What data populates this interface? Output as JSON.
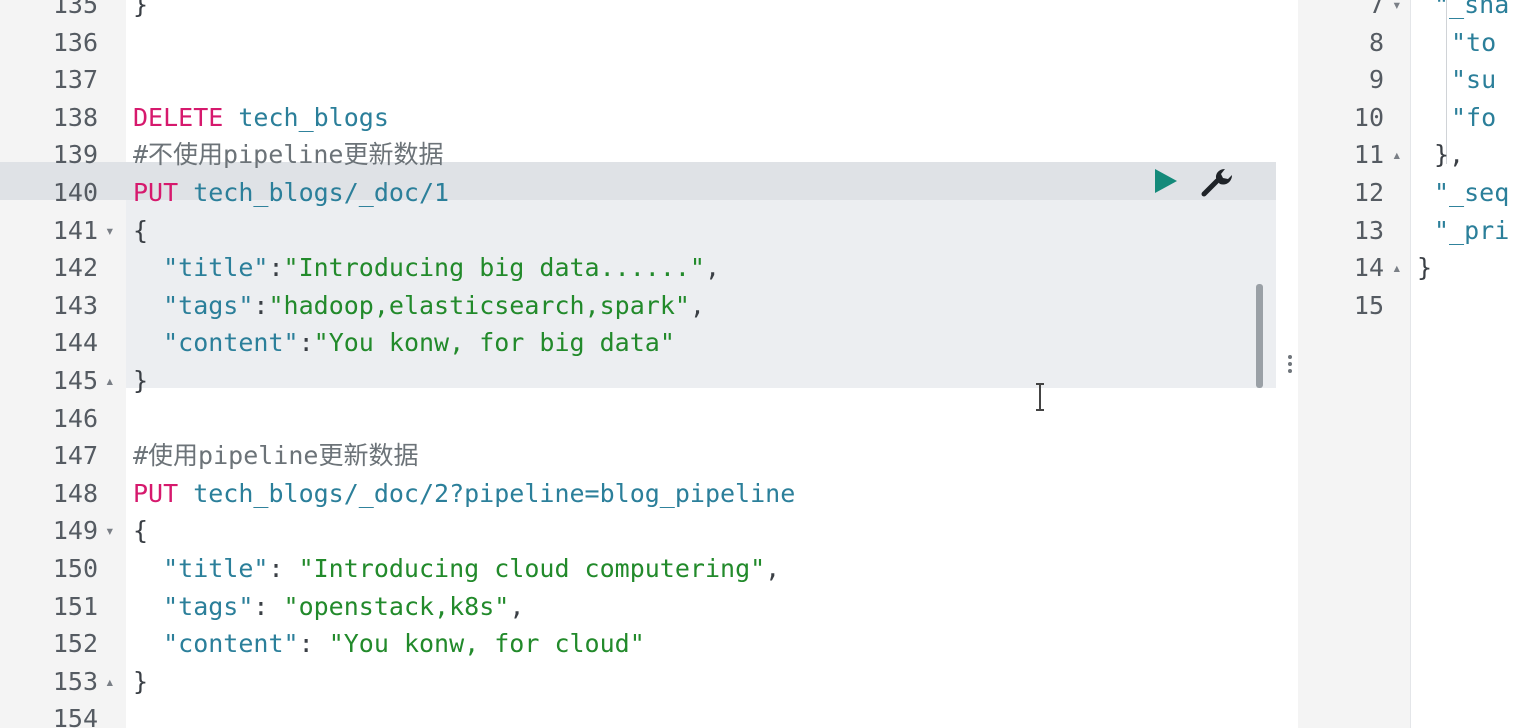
{
  "left_editor": {
    "lines": [
      {
        "num": "135",
        "fold": "",
        "parts": [
          {
            "t": "}",
            "c": "punc"
          }
        ]
      },
      {
        "num": "136",
        "fold": "",
        "parts": []
      },
      {
        "num": "137",
        "fold": "",
        "parts": []
      },
      {
        "num": "138",
        "fold": "",
        "parts": [
          {
            "t": "DELETE",
            "c": "kw"
          },
          {
            "t": " tech_blogs",
            "c": "path"
          }
        ]
      },
      {
        "num": "139",
        "fold": "",
        "parts": [
          {
            "t": "#不使用pipeline更新数据",
            "c": "comment"
          }
        ]
      },
      {
        "num": "140",
        "fold": "",
        "parts": [
          {
            "t": "PUT",
            "c": "kw"
          },
          {
            "t": " tech_blogs/_doc/1",
            "c": "path"
          }
        ]
      },
      {
        "num": "141",
        "fold": "▾",
        "parts": [
          {
            "t": "{",
            "c": "punc"
          }
        ]
      },
      {
        "num": "142",
        "fold": "",
        "parts": [
          {
            "t": "  \"title\"",
            "c": "key"
          },
          {
            "t": ":",
            "c": "punc"
          },
          {
            "t": "\"Introducing big data......\"",
            "c": "str"
          },
          {
            "t": ",",
            "c": "punc"
          }
        ]
      },
      {
        "num": "143",
        "fold": "",
        "parts": [
          {
            "t": "  \"tags\"",
            "c": "key"
          },
          {
            "t": ":",
            "c": "punc"
          },
          {
            "t": "\"hadoop,elasticsearch,spark\"",
            "c": "str"
          },
          {
            "t": ",",
            "c": "punc"
          }
        ]
      },
      {
        "num": "144",
        "fold": "",
        "parts": [
          {
            "t": "  \"content\"",
            "c": "key"
          },
          {
            "t": ":",
            "c": "punc"
          },
          {
            "t": "\"You konw, for big data\"",
            "c": "str"
          }
        ]
      },
      {
        "num": "145",
        "fold": "▴",
        "parts": [
          {
            "t": "}",
            "c": "punc"
          }
        ]
      },
      {
        "num": "146",
        "fold": "",
        "parts": []
      },
      {
        "num": "147",
        "fold": "",
        "parts": [
          {
            "t": "#使用pipeline更新数据",
            "c": "comment"
          }
        ]
      },
      {
        "num": "148",
        "fold": "",
        "parts": [
          {
            "t": "PUT",
            "c": "kw"
          },
          {
            "t": " tech_blogs/_doc/2?pipeline=blog_pipeline",
            "c": "path"
          }
        ]
      },
      {
        "num": "149",
        "fold": "▾",
        "parts": [
          {
            "t": "{",
            "c": "punc"
          }
        ]
      },
      {
        "num": "150",
        "fold": "",
        "parts": [
          {
            "t": "  \"title\"",
            "c": "key"
          },
          {
            "t": ": ",
            "c": "punc"
          },
          {
            "t": "\"Introducing cloud computering\"",
            "c": "str"
          },
          {
            "t": ",",
            "c": "punc"
          }
        ]
      },
      {
        "num": "151",
        "fold": "",
        "parts": [
          {
            "t": "  \"tags\"",
            "c": "key"
          },
          {
            "t": ": ",
            "c": "punc"
          },
          {
            "t": "\"openstack,k8s\"",
            "c": "str"
          },
          {
            "t": ",",
            "c": "punc"
          }
        ]
      },
      {
        "num": "152",
        "fold": "",
        "parts": [
          {
            "t": "  \"content\"",
            "c": "key"
          },
          {
            "t": ": ",
            "c": "punc"
          },
          {
            "t": "\"You konw, for cloud\"",
            "c": "str"
          }
        ]
      },
      {
        "num": "153",
        "fold": "▴",
        "parts": [
          {
            "t": "}",
            "c": "punc"
          }
        ]
      },
      {
        "num": "154",
        "fold": "",
        "parts": []
      }
    ],
    "active_line": "140",
    "run_icon": "play-icon",
    "wrench_icon": "wrench-icon"
  },
  "right_panel": {
    "lines": [
      {
        "num": "7",
        "fold": "▾",
        "text": "\"_sha",
        "c": "key",
        "indent": 2
      },
      {
        "num": "8",
        "fold": "",
        "text": "\"to",
        "c": "key",
        "indent": 3
      },
      {
        "num": "9",
        "fold": "",
        "text": "\"su",
        "c": "key",
        "indent": 3
      },
      {
        "num": "10",
        "fold": "",
        "text": "\"fo",
        "c": "key",
        "indent": 3
      },
      {
        "num": "11",
        "fold": "▴",
        "text": "},",
        "c": "punc",
        "indent": 2
      },
      {
        "num": "12",
        "fold": "",
        "text": "\"_seq",
        "c": "key",
        "indent": 2
      },
      {
        "num": "13",
        "fold": "",
        "text": "\"_pri",
        "c": "key",
        "indent": 2
      },
      {
        "num": "14",
        "fold": "▴",
        "text": "}",
        "c": "punc",
        "indent": 1
      },
      {
        "num": "15",
        "fold": "",
        "text": "",
        "c": "punc",
        "indent": 0
      }
    ]
  },
  "colors": {
    "keyword": "#d6196d",
    "path": "#2b7f9a",
    "string": "#228a2b",
    "comment": "#6c7378",
    "run_button": "#148a7a"
  }
}
